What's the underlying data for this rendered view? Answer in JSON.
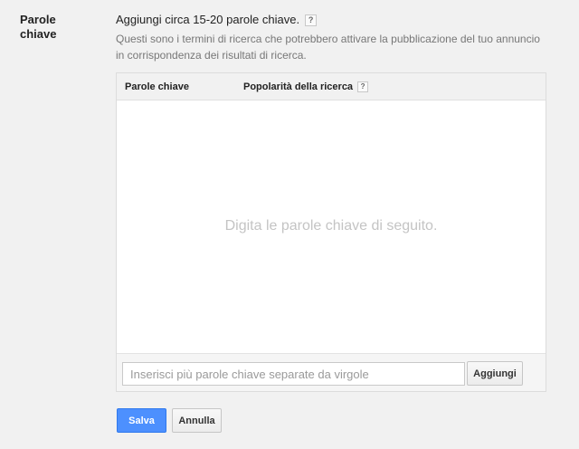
{
  "section": {
    "label_line1": "Parole",
    "label_line2": "chiave"
  },
  "intro": {
    "headline": "Aggiungi circa 15-20 parole chiave.",
    "help_glyph": "?",
    "description": "Questi sono i termini di ricerca che potrebbero attivare la pubblicazione del tuo annuncio in corrispondenza dei risultati di ricerca."
  },
  "table": {
    "columns": [
      "Parole chiave",
      "Popolarità della ricerca"
    ],
    "help_glyph": "?",
    "empty_message": "Digita le parole chiave di seguito."
  },
  "input": {
    "placeholder": "Inserisci più parole chiave separate da virgole",
    "value": ""
  },
  "buttons": {
    "add": "Aggiungi",
    "save": "Salva",
    "cancel": "Annulla"
  },
  "colors": {
    "primary": "#4d90fe",
    "background": "#f1f1f1"
  }
}
